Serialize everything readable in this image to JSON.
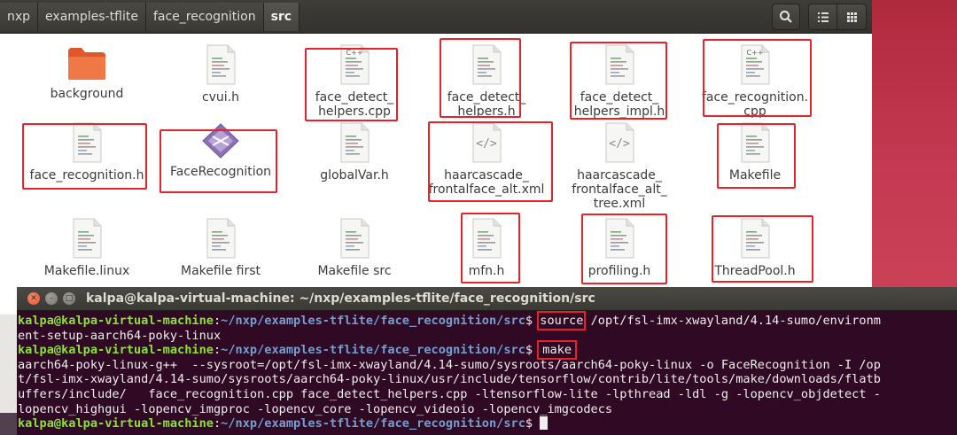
{
  "breadcrumbs": [
    "nxp",
    "examples-tflite",
    "face_recognition",
    "src"
  ],
  "header_buttons": {
    "search": "search-icon",
    "list": "list-view-icon",
    "grid": "grid-view-icon"
  },
  "files": [
    {
      "name": "background",
      "type": "folder",
      "highlighted": false
    },
    {
      "name": "cvui.h",
      "type": "text",
      "highlighted": false
    },
    {
      "name": "face_detect_\nhelpers.cpp",
      "type": "cpp",
      "highlighted": true
    },
    {
      "name": "face_detect_\nhelpers.h",
      "type": "text",
      "highlighted": true
    },
    {
      "name": "face_detect_\nhelpers_impl.h",
      "type": "text",
      "highlighted": true
    },
    {
      "name": "face_recognition.\ncpp",
      "type": "cpp",
      "highlighted": true
    },
    {
      "name": "face_recognition.h",
      "type": "text",
      "highlighted": true
    },
    {
      "name": "FaceRecognition",
      "type": "exec",
      "highlighted": true
    },
    {
      "name": "globalVar.h",
      "type": "text",
      "highlighted": false
    },
    {
      "name": "haarcascade_\nfrontalface_alt.xml",
      "type": "xml",
      "highlighted": true
    },
    {
      "name": "haarcascade_\nfrontalface_alt_\ntree.xml",
      "type": "xml",
      "highlighted": false
    },
    {
      "name": "Makefile",
      "type": "text",
      "highlighted": true
    },
    {
      "name": "Makefile.linux",
      "type": "text",
      "highlighted": false
    },
    {
      "name": "Makefile first",
      "type": "text",
      "highlighted": false
    },
    {
      "name": "Makefile src",
      "type": "text",
      "highlighted": false
    },
    {
      "name": "mfn.h",
      "type": "text",
      "highlighted": true
    },
    {
      "name": "profiling.h",
      "type": "text",
      "highlighted": true
    },
    {
      "name": "ThreadPool.h",
      "type": "text",
      "highlighted": true
    }
  ],
  "terminal": {
    "title": "kalpa@kalpa-virtual-machine: ~/nxp/examples-tflite/face_recognition/src",
    "prompt_user": "kalpa@kalpa-virtual-machine",
    "prompt_sep": ":",
    "prompt_path": "~/nxp/examples-tflite/face_recognition/src",
    "prompt_end": "$ ",
    "cmd1": "source",
    "cmd1_rest": " /opt/fsl-imx-xwayland/4.14-sumo/environm",
    "cmd1_wrap": "ent-setup-aarch64-poky-linux",
    "cmd2": "make",
    "output": [
      "aarch64-poky-linux-g++  --sysroot=/opt/fsl-imx-xwayland/4.14-sumo/sysroots/aarch64-poky-linux -o FaceRecognition -I /op",
      "t/fsl-imx-xwayland/4.14-sumo/sysroots/aarch64-poky-linux/usr/include/tensorflow/contrib/lite/tools/make/downloads/flatb",
      "uffers/include/   face_recognition.cpp face_detect_helpers.cpp -ltensorflow-lite -lpthread -ldl -g -lopencv_objdetect -",
      "lopencv_highgui -lopencv_imgproc -lopencv_core -lopencv_videoio -lopencv_imgcodecs"
    ]
  },
  "colors": {
    "highlight": "#e8222b",
    "terminal_bg": "#300a24",
    "prompt_user": "#8ae234",
    "prompt_path": "#729fcf"
  }
}
